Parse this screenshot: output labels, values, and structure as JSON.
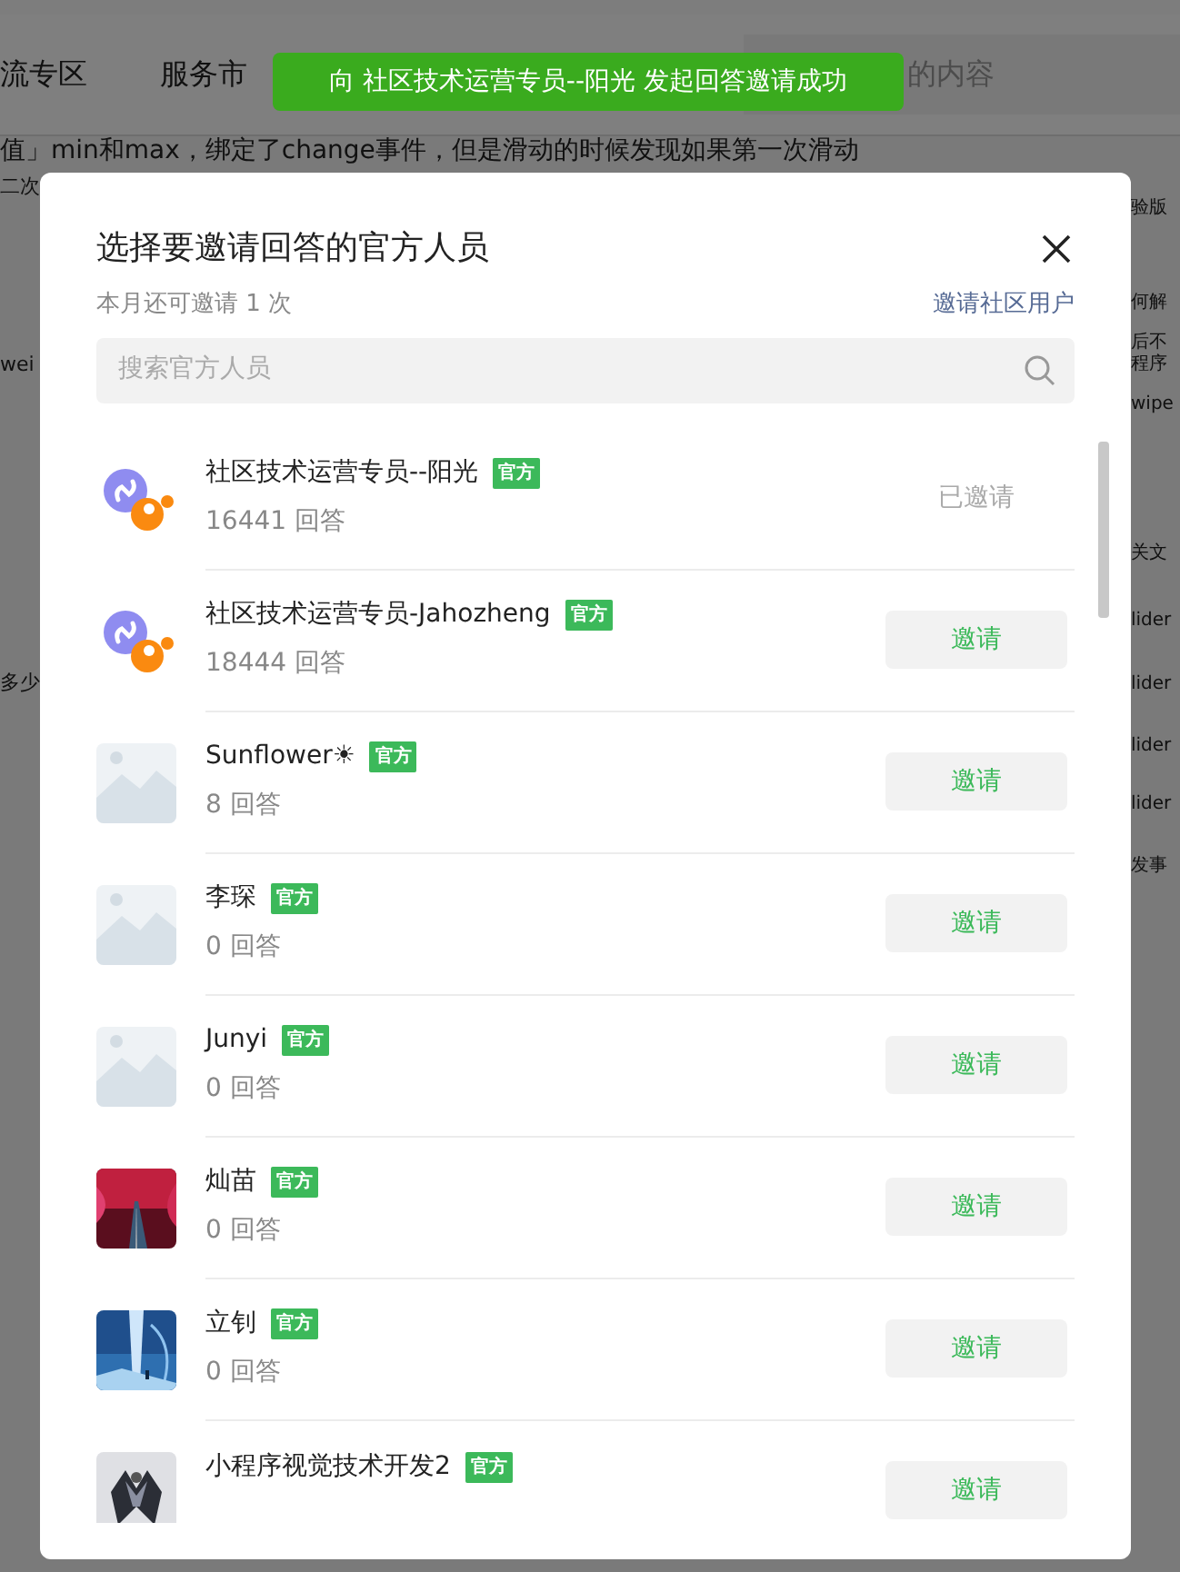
{
  "background_page": {
    "nav_items": [
      "流专区",
      "服务市"
    ],
    "search_placeholder": "的内容",
    "question_line": "值」min和max，绑定了change事件，但是滑动的时候发现如果第一次滑动",
    "left_fragments": [
      "二次",
      "wei",
      "多少"
    ],
    "right_fragments": [
      "验版",
      "何解",
      "后不",
      "程序",
      "wipe",
      "关文",
      "lider",
      "lider",
      "lider",
      "lider",
      "发事"
    ]
  },
  "toast": {
    "text": "向 社区技术运营专员--阳光 发起回答邀请成功"
  },
  "dialog": {
    "title": "选择要邀请回答的官方人员",
    "quota": "本月还可邀请 1 次",
    "invite_community_link": "邀请社区用户",
    "search": {
      "placeholder": "搜索官方人员"
    },
    "people": [
      {
        "kind": "logo",
        "name": "社区技术运营专员--阳光",
        "badge": "官方",
        "answers": "16441 回答",
        "invited": true,
        "action": "已邀请"
      },
      {
        "kind": "logo",
        "name": "社区技术运营专员-Jahozheng",
        "badge": "官方",
        "answers": "18444 回答",
        "invited": false,
        "action": "邀请"
      },
      {
        "kind": "placeholder",
        "name": "Sunflower☀",
        "badge": "官方",
        "answers": "8 回答",
        "invited": false,
        "action": "邀请"
      },
      {
        "kind": "placeholder",
        "name": "李琛",
        "badge": "官方",
        "answers": "0 回答",
        "invited": false,
        "action": "邀请"
      },
      {
        "kind": "placeholder",
        "name": "Junyi",
        "badge": "官方",
        "answers": "0 回答",
        "invited": false,
        "action": "邀请"
      },
      {
        "kind": "picture",
        "name": "灿苗",
        "badge": "官方",
        "answers": "0 回答",
        "invited": false,
        "action": "邀请"
      },
      {
        "kind": "picture",
        "name": "立钊",
        "badge": "官方",
        "answers": "0 回答",
        "invited": false,
        "action": "邀请"
      },
      {
        "kind": "picture",
        "name": "小程序视觉技术开发2",
        "badge": "官方",
        "invited": false,
        "action": "邀请"
      }
    ]
  }
}
